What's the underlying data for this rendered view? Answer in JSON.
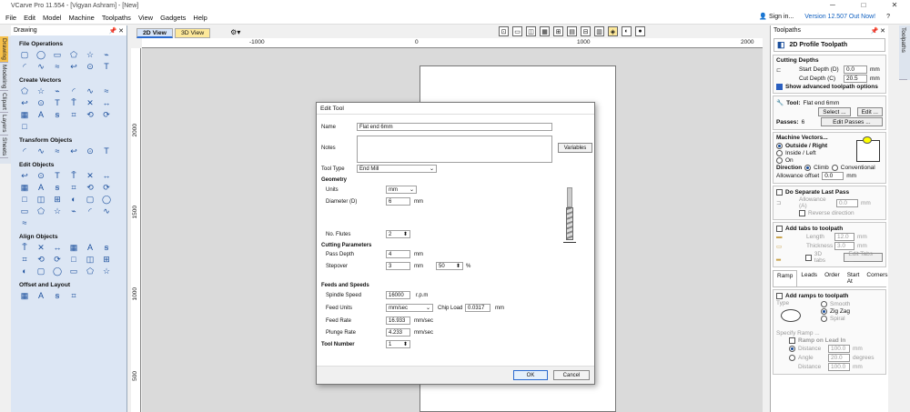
{
  "window": {
    "title": "VCarve Pro 11.554 - [Vigyan Ashram] - [New]",
    "minimize": "─",
    "maximize": "□",
    "close": "✕"
  },
  "menu": [
    "File",
    "Edit",
    "Model",
    "Machine",
    "Toolpaths",
    "View",
    "Gadgets",
    "Help"
  ],
  "signin": "Sign in...",
  "version": "Version 12.507 Out Now!",
  "help": "?",
  "left_tabs": [
    "Drawing",
    "Modeling",
    "Clipart",
    "Layers",
    "Sheets"
  ],
  "left_panel": {
    "title": "Drawing",
    "pin": "📌",
    "close": "✕",
    "sections": [
      {
        "title": "File Operations",
        "icons": [
          "new-file",
          "open-file",
          "save-file",
          "open-folder",
          "import",
          "import-2",
          "export",
          "copy",
          "paste",
          "folder-lock",
          "undo",
          "redo"
        ]
      },
      {
        "title": "Create Vectors",
        "icons": [
          "circle",
          "ellipse",
          "rectangle",
          "polygon",
          "star",
          "polyline",
          "arc",
          "spline",
          "curve",
          "hook",
          "offset",
          "text",
          "text-on-arc",
          "cross",
          "dimension",
          "hatch",
          "vector-text",
          "bezier",
          "measure"
        ]
      },
      {
        "title": "Transform Objects",
        "icons": [
          "move",
          "rotate",
          "scale",
          "mirror",
          "distort",
          "align-node"
        ]
      },
      {
        "title": "Edit Objects",
        "icons": [
          "select",
          "node-edit",
          "insert-node",
          "trim",
          "extend",
          "join",
          "weld",
          "subtract",
          "intersect",
          "cut",
          "trim-scissors",
          "fillet",
          "group",
          "ungroup",
          "smooth",
          "corner",
          "break",
          "mirror-edit",
          "scale-edit",
          "fillet-edit",
          "copy-edit",
          "curve-fit",
          "close-vector",
          "join-vector",
          "offset-edit"
        ]
      },
      {
        "title": "Align Objects",
        "icons": [
          "align-center",
          "align-left-c",
          "align-center-v",
          "align-left",
          "align-right",
          "align-top",
          "align-middle",
          "align-bottom",
          "align-distribute",
          "distribute-h",
          "distribute-v",
          "space-even",
          "nest",
          "group-align",
          "center-page",
          "align-v2",
          "align-h2",
          "align-h3"
        ]
      },
      {
        "title": "Offset and Layout",
        "icons": [
          "offset-vector",
          "array-copy",
          "circular-array",
          "nest-parts"
        ]
      }
    ]
  },
  "views": {
    "v2d": "2D View",
    "v3d": "3D View"
  },
  "ruler": {
    "h": [
      "-1000",
      "0",
      "1000",
      "2000"
    ],
    "v": [
      "2000",
      "1500",
      "1000",
      "500"
    ]
  },
  "toolpaths_panel": {
    "title": "Toolpaths",
    "pin": "📌",
    "close": "✕",
    "toolpath_name": "2D Profile Toolpath",
    "cutting_depths": {
      "heading": "Cutting Depths",
      "start_label": "Start Depth (D)",
      "start_value": "0.0",
      "cut_label": "Cut Depth (C)",
      "cut_value": "20.5",
      "unit": "mm",
      "show_advanced": "Show advanced toolpath options"
    },
    "tool": {
      "label": "Tool:",
      "name": "Flat end 6mm",
      "select": "Select ...",
      "edit": "Edit ...",
      "passes_label": "Passes:",
      "passes_value": "6",
      "edit_passes": "Edit Passes ..."
    },
    "machine_vectors": {
      "heading": "Machine Vectors...",
      "outside": "Outside / Right",
      "inside": "Inside / Left",
      "on": "On",
      "direction": "Direction",
      "climb": "Climb",
      "conventional": "Conventional",
      "allowance_label": "Allowance offset",
      "allowance_value": "0.0",
      "unit": "mm"
    },
    "last_pass": {
      "label": "Do Separate Last Pass",
      "allowance_label": "Allowance (A)",
      "allowance_value": "0.0",
      "unit": "mm",
      "reverse": "Reverse direction"
    },
    "tabs": {
      "label": "Add tabs to toolpath",
      "length_label": "Length",
      "length_value": "12.0",
      "thickness_label": "Thickness",
      "thickness_value": "3.0",
      "unit": "mm",
      "tabs3d": "3D tabs",
      "edit": "Edit Tabs ..."
    },
    "subtabs": [
      "Ramp",
      "Leads",
      "Order",
      "Start At",
      "Corners"
    ],
    "ramp": {
      "label": "Add ramps to toolpath",
      "type": "Type",
      "smooth": "Smooth",
      "zigzag": "Zig Zag",
      "spiral": "Spiral",
      "specify": "Specify Ramp ...",
      "lead_in": "Ramp on Lead In",
      "distance_label": "Distance",
      "distance_value": "100.0",
      "angle_label": "Angle",
      "angle_value": "20.0",
      "degrees": "degrees",
      "distance2_label": "Distance",
      "distance2_value": "100.0",
      "unit": "mm"
    }
  },
  "right_tab": "Toolpaths",
  "dialog": {
    "title": "Edit Tool",
    "name_label": "Name",
    "name_value": "Flat end 6mm",
    "notes_label": "Notes",
    "variables": "Variables",
    "tooltype_label": "Tool Type",
    "tooltype_value": "End Mill",
    "geometry": "Geometry",
    "units_label": "Units",
    "units_value": "mm",
    "diameter_label": "Diameter (D)",
    "diameter_value": "6",
    "mm": "mm",
    "flutes_label": "No. Flutes",
    "flutes_value": "2",
    "cutting": "Cutting Parameters",
    "passdepth_label": "Pass Depth",
    "passdepth_value": "4",
    "stepover_label": "Stepover",
    "stepover_value": "3",
    "stepover_pct": "50",
    "pct": "%",
    "feeds": "Feeds and Speeds",
    "spindle_label": "Spindle Speed",
    "spindle_value": "16000",
    "rpm": "r.p.m",
    "feedunits_label": "Feed Units",
    "feedunits_value": "mm/sec",
    "chipload_label": "Chip Load",
    "chipload_value": "0.0317",
    "feedrate_label": "Feed Rate",
    "feedrate_value": "16.933",
    "plunge_label": "Plunge Rate",
    "plunge_value": "4.233",
    "mmsec": "mm/sec",
    "toolnum_label": "Tool Number",
    "toolnum_value": "1",
    "ok": "OK",
    "cancel": "Cancel"
  }
}
